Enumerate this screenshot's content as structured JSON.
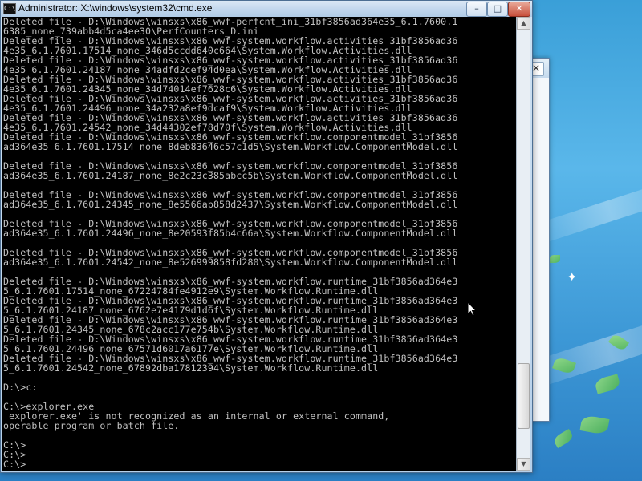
{
  "window": {
    "title": "Administrator: X:\\windows\\system32\\cmd.exe",
    "icon_label": "C:\\",
    "buttons": {
      "minimize": "–",
      "maximize": "□",
      "close": "✕"
    }
  },
  "background_window": {
    "close": "✕"
  },
  "scrollbar": {
    "up": "▲",
    "down": "▼",
    "thumb_position_fraction": 0.92
  },
  "console": {
    "lines": [
      "Deleted file - D:\\Windows\\winsxs\\x86_wwf-perfcnt_ini_31bf3856ad364e35_6.1.7600.1",
      "6385_none_739abb4d5ca4ee30\\PerfCounters_D.ini",
      "Deleted file - D:\\Windows\\winsxs\\x86_wwf-system.workflow.activities_31bf3856ad36",
      "4e35_6.1.7601.17514_none_346d5ccdd640c664\\System.Workflow.Activities.dll",
      "Deleted file - D:\\Windows\\winsxs\\x86_wwf-system.workflow.activities_31bf3856ad36",
      "4e35_6.1.7601.24187_none_34adfd2cef94d0ea\\System.Workflow.Activities.dll",
      "Deleted file - D:\\Windows\\winsxs\\x86_wwf-system.workflow.activities_31bf3856ad36",
      "4e35_6.1.7601.24345_none_34d74014ef7628c6\\System.Workflow.Activities.dll",
      "Deleted file - D:\\Windows\\winsxs\\x86_wwf-system.workflow.activities_31bf3856ad36",
      "4e35_6.1.7601.24496_none_34a232a8ef9dcaf9\\System.Workflow.Activities.dll",
      "Deleted file - D:\\Windows\\winsxs\\x86_wwf-system.workflow.activities_31bf3856ad36",
      "4e35_6.1.7601.24542_none_34d44302ef78d70f\\System.Workflow.Activities.dll",
      "Deleted file - D:\\Windows\\winsxs\\x86_wwf-system.workflow.componentmodel_31bf3856",
      "ad364e35_6.1.7601.17514_none_8deb83646c57c1d5\\System.Workflow.ComponentModel.dll",
      "",
      "Deleted file - D:\\Windows\\winsxs\\x86_wwf-system.workflow.componentmodel_31bf3856",
      "ad364e35_6.1.7601.24187_none_8e2c23c385abcc5b\\System.Workflow.ComponentModel.dll",
      "",
      "Deleted file - D:\\Windows\\winsxs\\x86_wwf-system.workflow.componentmodel_31bf3856",
      "ad364e35_6.1.7601.24345_none_8e5566ab858d2437\\System.Workflow.ComponentModel.dll",
      "",
      "Deleted file - D:\\Windows\\winsxs\\x86_wwf-system.workflow.componentmodel_31bf3856",
      "ad364e35_6.1.7601.24496_none_8e20593f85b4c66a\\System.Workflow.ComponentModel.dll",
      "",
      "Deleted file - D:\\Windows\\winsxs\\x86_wwf-system.workflow.componentmodel_31bf3856",
      "ad364e35_6.1.7601.24542_none_8e526999858fd280\\System.Workflow.ComponentModel.dll",
      "",
      "Deleted file - D:\\Windows\\winsxs\\x86_wwf-system.workflow.runtime_31bf3856ad364e3",
      "5_6.1.7601.17514_none_67224784fe4912e9\\System.Workflow.Runtime.dll",
      "Deleted file - D:\\Windows\\winsxs\\x86_wwf-system.workflow.runtime_31bf3856ad364e3",
      "5_6.1.7601.24187_none_6762e7e4179d1d6f\\System.Workflow.Runtime.dll",
      "Deleted file - D:\\Windows\\winsxs\\x86_wwf-system.workflow.runtime_31bf3856ad364e3",
      "5_6.1.7601.24345_none_678c2acc177e754b\\System.Workflow.Runtime.dll",
      "Deleted file - D:\\Windows\\winsxs\\x86_wwf-system.workflow.runtime_31bf3856ad364e3",
      "5_6.1.7601.24496_none_67571d6017a6177e\\System.Workflow.Runtime.dll",
      "Deleted file - D:\\Windows\\winsxs\\x86_wwf-system.workflow.runtime_31bf3856ad364e3",
      "5_6.1.7601.24542_none_67892dba17812394\\System.Workflow.Runtime.dll",
      "",
      "D:\\>c:",
      "",
      "C:\\>explorer.exe",
      "'explorer.exe' is not recognized as an internal or external command,",
      "operable program or batch file.",
      "",
      "C:\\>",
      "C:\\>",
      "C:\\>"
    ]
  }
}
